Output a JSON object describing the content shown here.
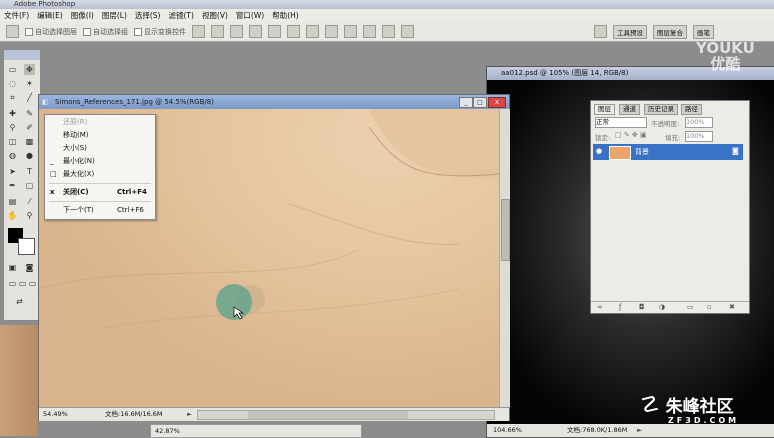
{
  "app": {
    "title": "Adobe Photoshop"
  },
  "menu": [
    "文件(F)",
    "编辑(E)",
    "图像(I)",
    "图层(L)",
    "选择(S)",
    "滤镜(T)",
    "视图(V)",
    "窗口(W)",
    "帮助(H)"
  ],
  "options_bar": {
    "auto_select_group": "自动选择图层",
    "auto_select_layer": "自动选择组",
    "show_transform": "显示变换控件",
    "tabs": [
      "工具预设",
      "图层复合",
      "画笔"
    ]
  },
  "doc1": {
    "title": "Simons_References_171.jpg @ 54.5%(RGB/8)",
    "zoom": "54.49%",
    "doc_size": "文档:16.6M/16.6M"
  },
  "context_menu": {
    "items": [
      {
        "icon": "",
        "label": "还原(R)",
        "shortcut": ""
      },
      {
        "icon": "",
        "label": "移动(M)",
        "shortcut": ""
      },
      {
        "icon": "",
        "label": "大小(S)",
        "shortcut": ""
      },
      {
        "icon": "_",
        "label": "最小化(N)",
        "shortcut": ""
      },
      {
        "icon": "□",
        "label": "最大化(X)",
        "shortcut": ""
      },
      {
        "icon": "x",
        "label": "关闭(C)",
        "shortcut": "Ctrl+F4"
      },
      {
        "icon": "",
        "label": "下一个(T)",
        "shortcut": "Ctrl+F6"
      }
    ]
  },
  "doc2": {
    "title": "aa012.psd @ 105% (图层 14, RGB/8)",
    "zoom": "104.66%",
    "doc_size": "文档:768.0K/1.86M"
  },
  "layers_panel": {
    "tabs": [
      "图层",
      "通道",
      "历史记录",
      "路径"
    ],
    "blend_mode": "正常",
    "opacity_label": "不透明度:",
    "opacity": "100%",
    "lock_label": "锁定:",
    "fill_label": "填充:",
    "fill": "100%",
    "layer_name": "背景"
  },
  "bottom_bar": {
    "zoom": "42.87%"
  },
  "watermarks": {
    "youku_1": "YOUKU",
    "youku_2": "优酷",
    "zf3d": "朱峰社区",
    "zf3d_url": "ZF3D.COM"
  }
}
